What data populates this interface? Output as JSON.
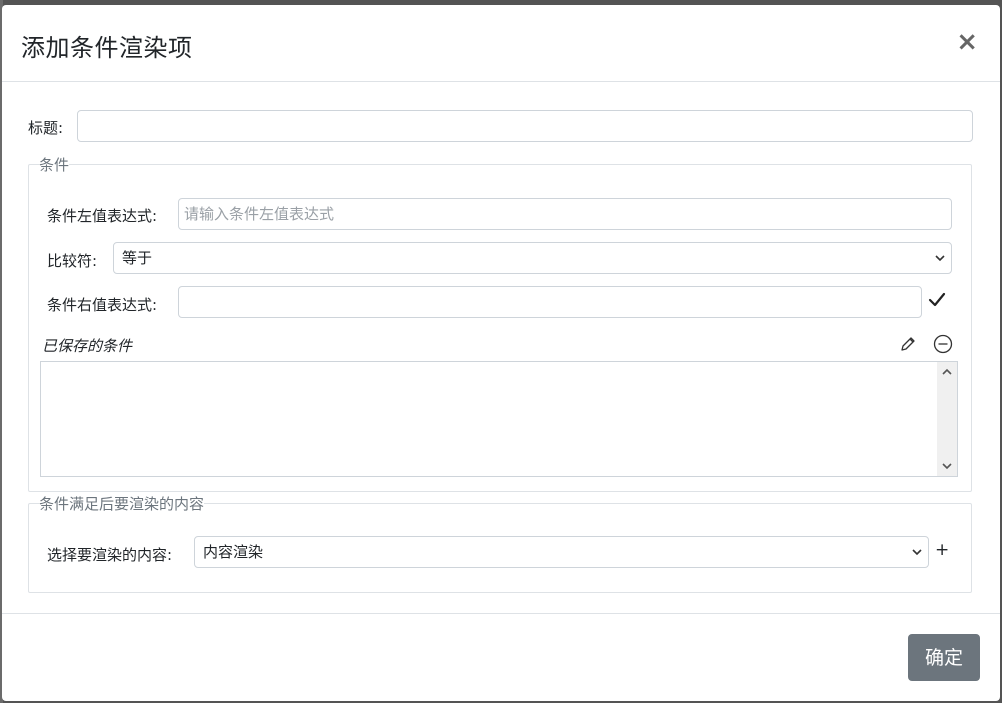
{
  "dialog": {
    "title": "添加条件渲染项",
    "close_symbol": "×"
  },
  "title_field": {
    "label": "标题:",
    "value": ""
  },
  "condition_section": {
    "legend": "条件",
    "left_expr": {
      "label": "条件左值表达式:",
      "value": "",
      "placeholder": "请输入条件左值表达式"
    },
    "comparator": {
      "label": "比较符:",
      "selected": "等于"
    },
    "right_expr": {
      "label": "条件右值表达式:",
      "value": ""
    },
    "saved": {
      "label": "已保存的条件",
      "items": []
    }
  },
  "content_section": {
    "legend": "条件满足后要渲染的内容",
    "select_label": "选择要渲染的内容:",
    "selected": "内容渲染",
    "add_symbol": "+"
  },
  "footer": {
    "confirm_label": "确定"
  },
  "icons": {
    "close": "close-icon",
    "confirm_condition": "checkmark-icon",
    "edit": "pencil-icon",
    "remove": "minus-circle-icon",
    "dropdown": "chevron-down-icon",
    "scroll_up": "chevron-up-icon",
    "scroll_down": "chevron-down-icon",
    "add": "plus-icon"
  },
  "colors": {
    "confirm_button": "#6c757d",
    "border": "#ced4da"
  }
}
